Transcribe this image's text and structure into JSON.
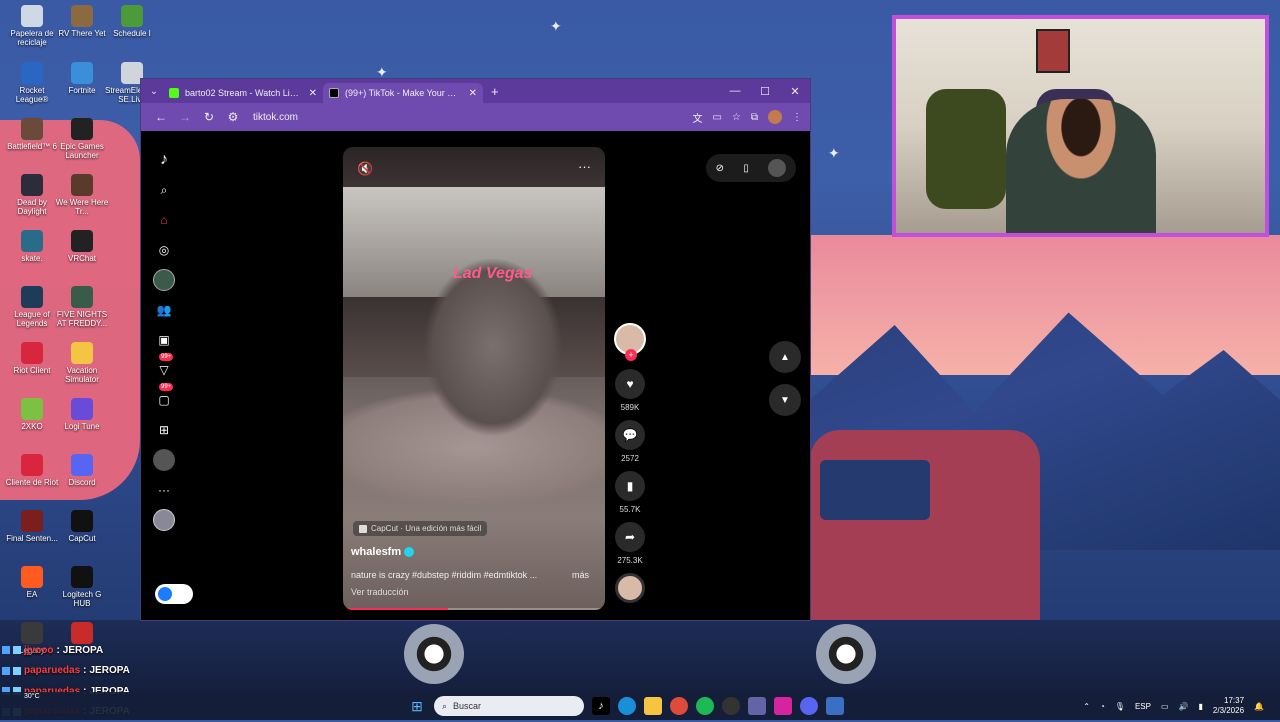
{
  "desktop": {
    "icons": [
      {
        "label": "Papelera de reciclaje",
        "color": "#cfd8e6"
      },
      {
        "label": "RV There Yet",
        "color": "#8a6a3e"
      },
      {
        "label": "Schedule I",
        "color": "#4d9a3a"
      },
      {
        "label": "Rocket League®",
        "color": "#2a67c4"
      },
      {
        "label": "Fortnite",
        "color": "#3a8fd9"
      },
      {
        "label": "StreamElements SE.Live",
        "color": "#d0d4dc"
      },
      {
        "label": "Battlefield™ 6",
        "color": "#6a4a3a"
      },
      {
        "label": "Epic Games Launcher",
        "color": "#222222"
      },
      {
        "label": "Dead by Daylight",
        "color": "#2c2c3a"
      },
      {
        "label": "We Were Here Tr...",
        "color": "#5a3a2a"
      },
      {
        "label": "skate.",
        "color": "#2b6b8a"
      },
      {
        "label": "VRChat",
        "color": "#222222"
      },
      {
        "label": "League of Legends",
        "color": "#1f3b5a"
      },
      {
        "label": "FIVE NIGHTS AT FREDDY...",
        "color": "#3a5a4a"
      },
      {
        "label": "Riot Client",
        "color": "#d7263d"
      },
      {
        "label": "Vacation Simulator",
        "color": "#f4c542"
      },
      {
        "label": "2XKO",
        "color": "#7cc142"
      },
      {
        "label": "Logi Tune",
        "color": "#6a4ad9"
      },
      {
        "label": "Cliente de Riot",
        "color": "#d7263d"
      },
      {
        "label": "Discord",
        "color": "#5865f2"
      },
      {
        "label": "Final Senten...",
        "color": "#7a1e1e"
      },
      {
        "label": "CapCut",
        "color": "#111111"
      },
      {
        "label": "EA",
        "color": "#ff5a1f"
      },
      {
        "label": "Logitech G HUB",
        "color": "#111111"
      },
      {
        "label": "Legacy",
        "color": "#3a3a3a"
      },
      {
        "label": "",
        "color": "#c92a2a"
      }
    ]
  },
  "browser": {
    "tabs": [
      {
        "title": "barto02 Stream - Watch Live on",
        "fav_color": "#53fc18",
        "active": false
      },
      {
        "title": "(99+) TikTok - Make Your Day",
        "fav_color": "#000000",
        "active": true
      }
    ],
    "url": "tiktok.com"
  },
  "tiktok": {
    "sidebar_icons": [
      "tiktok-logo-icon",
      "search-icon",
      "home-icon",
      "explore-icon",
      "profile-avatar-icon",
      "following-icon",
      "live-icon",
      "activity-icon",
      "messages-icon",
      "upload-icon",
      "profile-icon",
      "more-icon",
      "friend-avatar-icon"
    ],
    "activity_badge": "99+",
    "messages_badge": "99+",
    "video": {
      "sign_text": "Lad Vegas",
      "capcut_label": "CapCut · Una edición más fácil",
      "author": "whalesfm",
      "caption": "nature is crazy #dubstep #riddim #edmtiktok ...",
      "more_label": "más",
      "translate_label": "Ver traducción",
      "progress": 0.4
    },
    "actions": {
      "likes": "589K",
      "comments": "2572",
      "saves": "55.7K",
      "shares": "275.3K"
    }
  },
  "chat": [
    {
      "user": "jjvooo",
      "msg": "JEROPA"
    },
    {
      "user": "paparuedas",
      "msg": "JEROPA"
    },
    {
      "user": "paparuedas",
      "msg": "JEROPA"
    },
    {
      "user": "paparuedas",
      "msg": "JEROPA"
    }
  ],
  "taskbar": {
    "search_placeholder": "Buscar",
    "weather": "30°C",
    "lang": "ESP",
    "time": "17:37",
    "date": "2/3/2026"
  }
}
